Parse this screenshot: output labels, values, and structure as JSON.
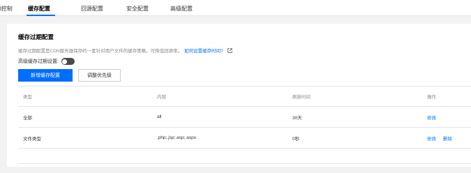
{
  "tabs": {
    "items": [
      {
        "label": "l控制"
      },
      {
        "label": "缓存配置"
      },
      {
        "label": "回源配置"
      },
      {
        "label": "安全配置"
      },
      {
        "label": "高级配置"
      }
    ],
    "active_index": 1
  },
  "section": {
    "title": "缓存过期配置",
    "description": "缓存过期配置是CDN服务器保存的一套针对用户文件的缓存策略，可降低回源率。",
    "help_link": "如何设置缓存时间?",
    "advanced_label": "高级缓存过期设置:",
    "advanced_enabled": false,
    "add_button": "新增缓存配置",
    "priority_button": "调整优先级"
  },
  "table": {
    "headers": [
      "类型",
      "内容",
      "刷新时间",
      "操作"
    ],
    "rows": [
      {
        "type": "全部",
        "content": "all",
        "time": "30天",
        "actions": [
          "修改"
        ]
      },
      {
        "type": "文件类型",
        "content": ".php;.jsp;.asp;.aspx",
        "time": "0秒",
        "actions": [
          "修改",
          "删除"
        ]
      }
    ]
  },
  "colors": {
    "accent": "#006eff",
    "toggle_off": "#4a4a4a"
  }
}
